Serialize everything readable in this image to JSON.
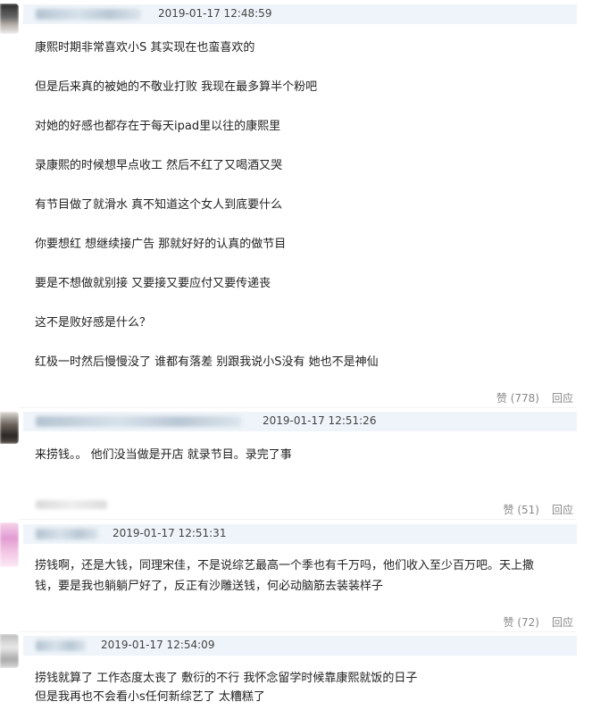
{
  "comments": [
    {
      "timestamp": "2019-01-17 12:48:59",
      "lines": [
        "康熙时期非常喜欢小S 其实现在也蛮喜欢的",
        "但是后来真的被她的不敬业打败 我现在最多算半个粉吧",
        "对她的好感也都存在于每天ipad里以往的康熙里",
        "录康熙的时候想早点收工 然后不红了又喝酒又哭",
        "有节目做了就滑水 真不知道这个女人到底要什么",
        "你要想红 想继续接广告 那就好好的认真的做节目",
        "要是不想做就别接 又要接又要应付又要传递丧",
        "这不是败好感是什么？",
        "红极一时然后慢慢没了 谁都有落差 别跟我说小S没有 她也不是神仙"
      ],
      "like_label": "赞 (778)",
      "reply_label": "回应"
    },
    {
      "timestamp": "2019-01-17 12:51:26",
      "lines": [
        "来捞钱。。 他们没当做是开店 就录节目。录完了事"
      ],
      "like_label": "赞 (51)",
      "reply_label": "回应"
    },
    {
      "timestamp": "2019-01-17 12:51:31",
      "lines": [
        "捞钱啊，还是大钱，同理宋佳，不是说综艺最高一个季也有千万吗，他们收入至少百万吧。天上撒",
        "钱，要是我也躺躺尸好了，反正有沙雕送钱，何必动脑筋去装装样子"
      ],
      "like_label": "赞 (72)",
      "reply_label": "回应"
    },
    {
      "timestamp": "2019-01-17 12:54:09",
      "lines": [
        "捞钱就算了 工作态度太丧了 敷衍的不行 我怀念留学时候靠康熙就饭的日子",
        "但是我再也不会看小s任何新综艺了 太糟糕了"
      ],
      "like_label": "",
      "reply_label": ""
    }
  ],
  "colors": {
    "header_bg": "#eef4f9",
    "action_text": "#888888",
    "body_text": "#222222"
  }
}
